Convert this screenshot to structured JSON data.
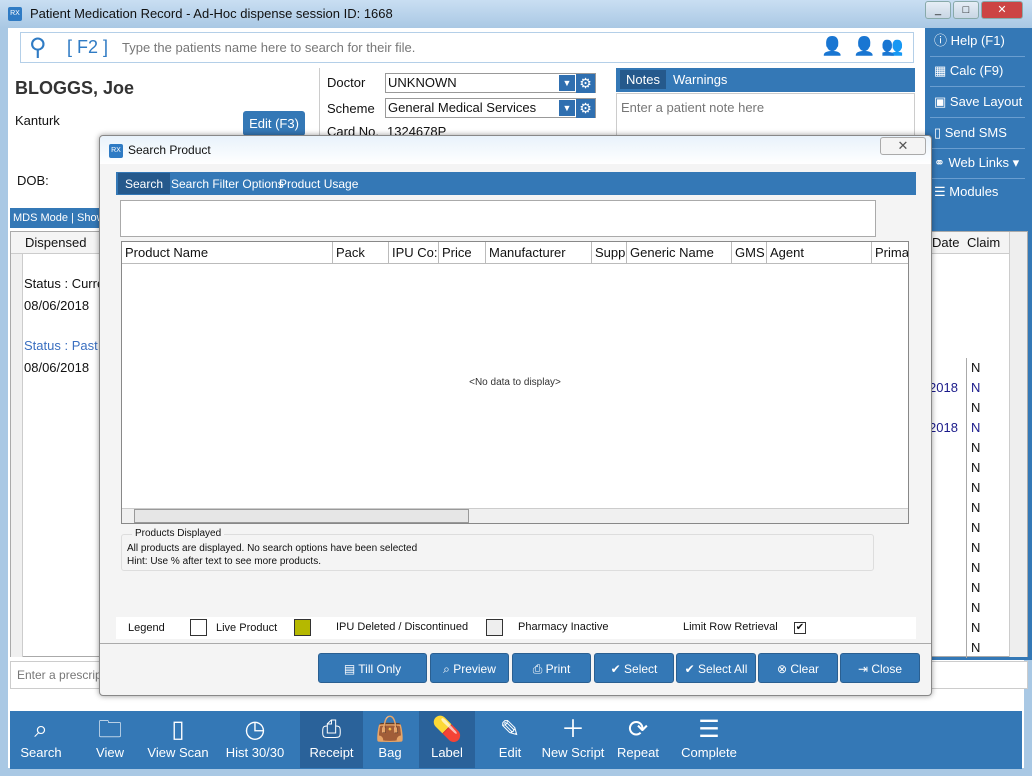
{
  "window": {
    "title": "Patient Medication Record - Ad-Hoc dispense session ID: 1668",
    "icon": "RX",
    "controls": [
      "_",
      "□",
      "✕"
    ]
  },
  "search": {
    "key_label": "[ F2 ]",
    "placeholder": "Type the patients name here to search for their file.",
    "icons": [
      "patient-search-icon",
      "add-patient-icon",
      "patients-group-icon"
    ]
  },
  "patient": {
    "name": "BLOGGS, Joe",
    "address": "Kanturk",
    "dob_label": "DOB:",
    "edit_label": "Edit (F3)"
  },
  "details": {
    "doctor_label": "Doctor",
    "doctor_value": "UNKNOWN",
    "scheme_label": "Scheme",
    "scheme_value": "General Medical Services",
    "card_label": "Card No.",
    "card_value": "1324678P"
  },
  "notes": {
    "tabs": [
      "Notes",
      "Warnings"
    ],
    "placeholder": "Enter a patient note here"
  },
  "sidebar": {
    "items": [
      "Help (F1)",
      "Calc (F9)",
      "Save Layout",
      "Send SMS",
      "Web Links ▾",
      "Modules"
    ],
    "icons": [
      "help-icon",
      "calculator-icon",
      "save-icon",
      "sms-icon",
      "link-icon",
      "modules-icon"
    ]
  },
  "mds_bar": {
    "items": [
      "MDS Mode",
      "Show"
    ]
  },
  "grid": {
    "col_dispensed": "Dispensed",
    "col_date": "Date",
    "col_claim": "Claim",
    "status_current": "Status : Curre",
    "status_past": "Status : Past",
    "dates": [
      "08/06/2018",
      "08/06/2018"
    ],
    "date_fragments": [
      "2018",
      "2018"
    ],
    "claims": [
      "N",
      "N",
      "N",
      "N",
      "N",
      "N",
      "N",
      "N",
      "N",
      "N",
      "N",
      "N",
      "N",
      "N",
      "N"
    ]
  },
  "prescription": {
    "placeholder": "Enter a prescriptio"
  },
  "toolbar": {
    "items": [
      "Search",
      "View",
      "View Scan",
      "Hist 30/30",
      "Receipt",
      "Bag",
      "Label",
      "Edit",
      "New Script",
      "Repeat",
      "Complete"
    ],
    "icons": [
      "⌕",
      "🗀",
      "▯",
      "◷",
      "⎙",
      "👜",
      "💊",
      "✎",
      "＋",
      "⟳",
      "☰"
    ]
  },
  "dialog": {
    "title": "Search Product",
    "tabs": [
      "Search",
      "Search Filter Options",
      "Product Usage"
    ],
    "columns": [
      "Product Name",
      "Pack",
      "IPU Co:",
      "Price",
      "Manufacturer",
      "Supp",
      "Generic Name",
      "GMS",
      "Agent",
      "Prima"
    ],
    "empty": "<No data to display>",
    "group_title": "Products Displayed",
    "group_line1": "All products are displayed. No search options have been selected",
    "group_line2": "Hint: Use % after text to see more products.",
    "legend": {
      "label": "Legend",
      "live": "Live Product",
      "deleted": "IPU Deleted / Discontinued",
      "inactive": "Pharmacy Inactive",
      "limit": "Limit Row Retrieval",
      "limit_checked": true,
      "deleted_color": "#b5b800"
    },
    "buttons": [
      "Till Only",
      "Preview",
      "Print",
      "Select",
      "Select All",
      "Clear",
      "Close"
    ]
  },
  "colors": {
    "accent": "#3478b6"
  }
}
